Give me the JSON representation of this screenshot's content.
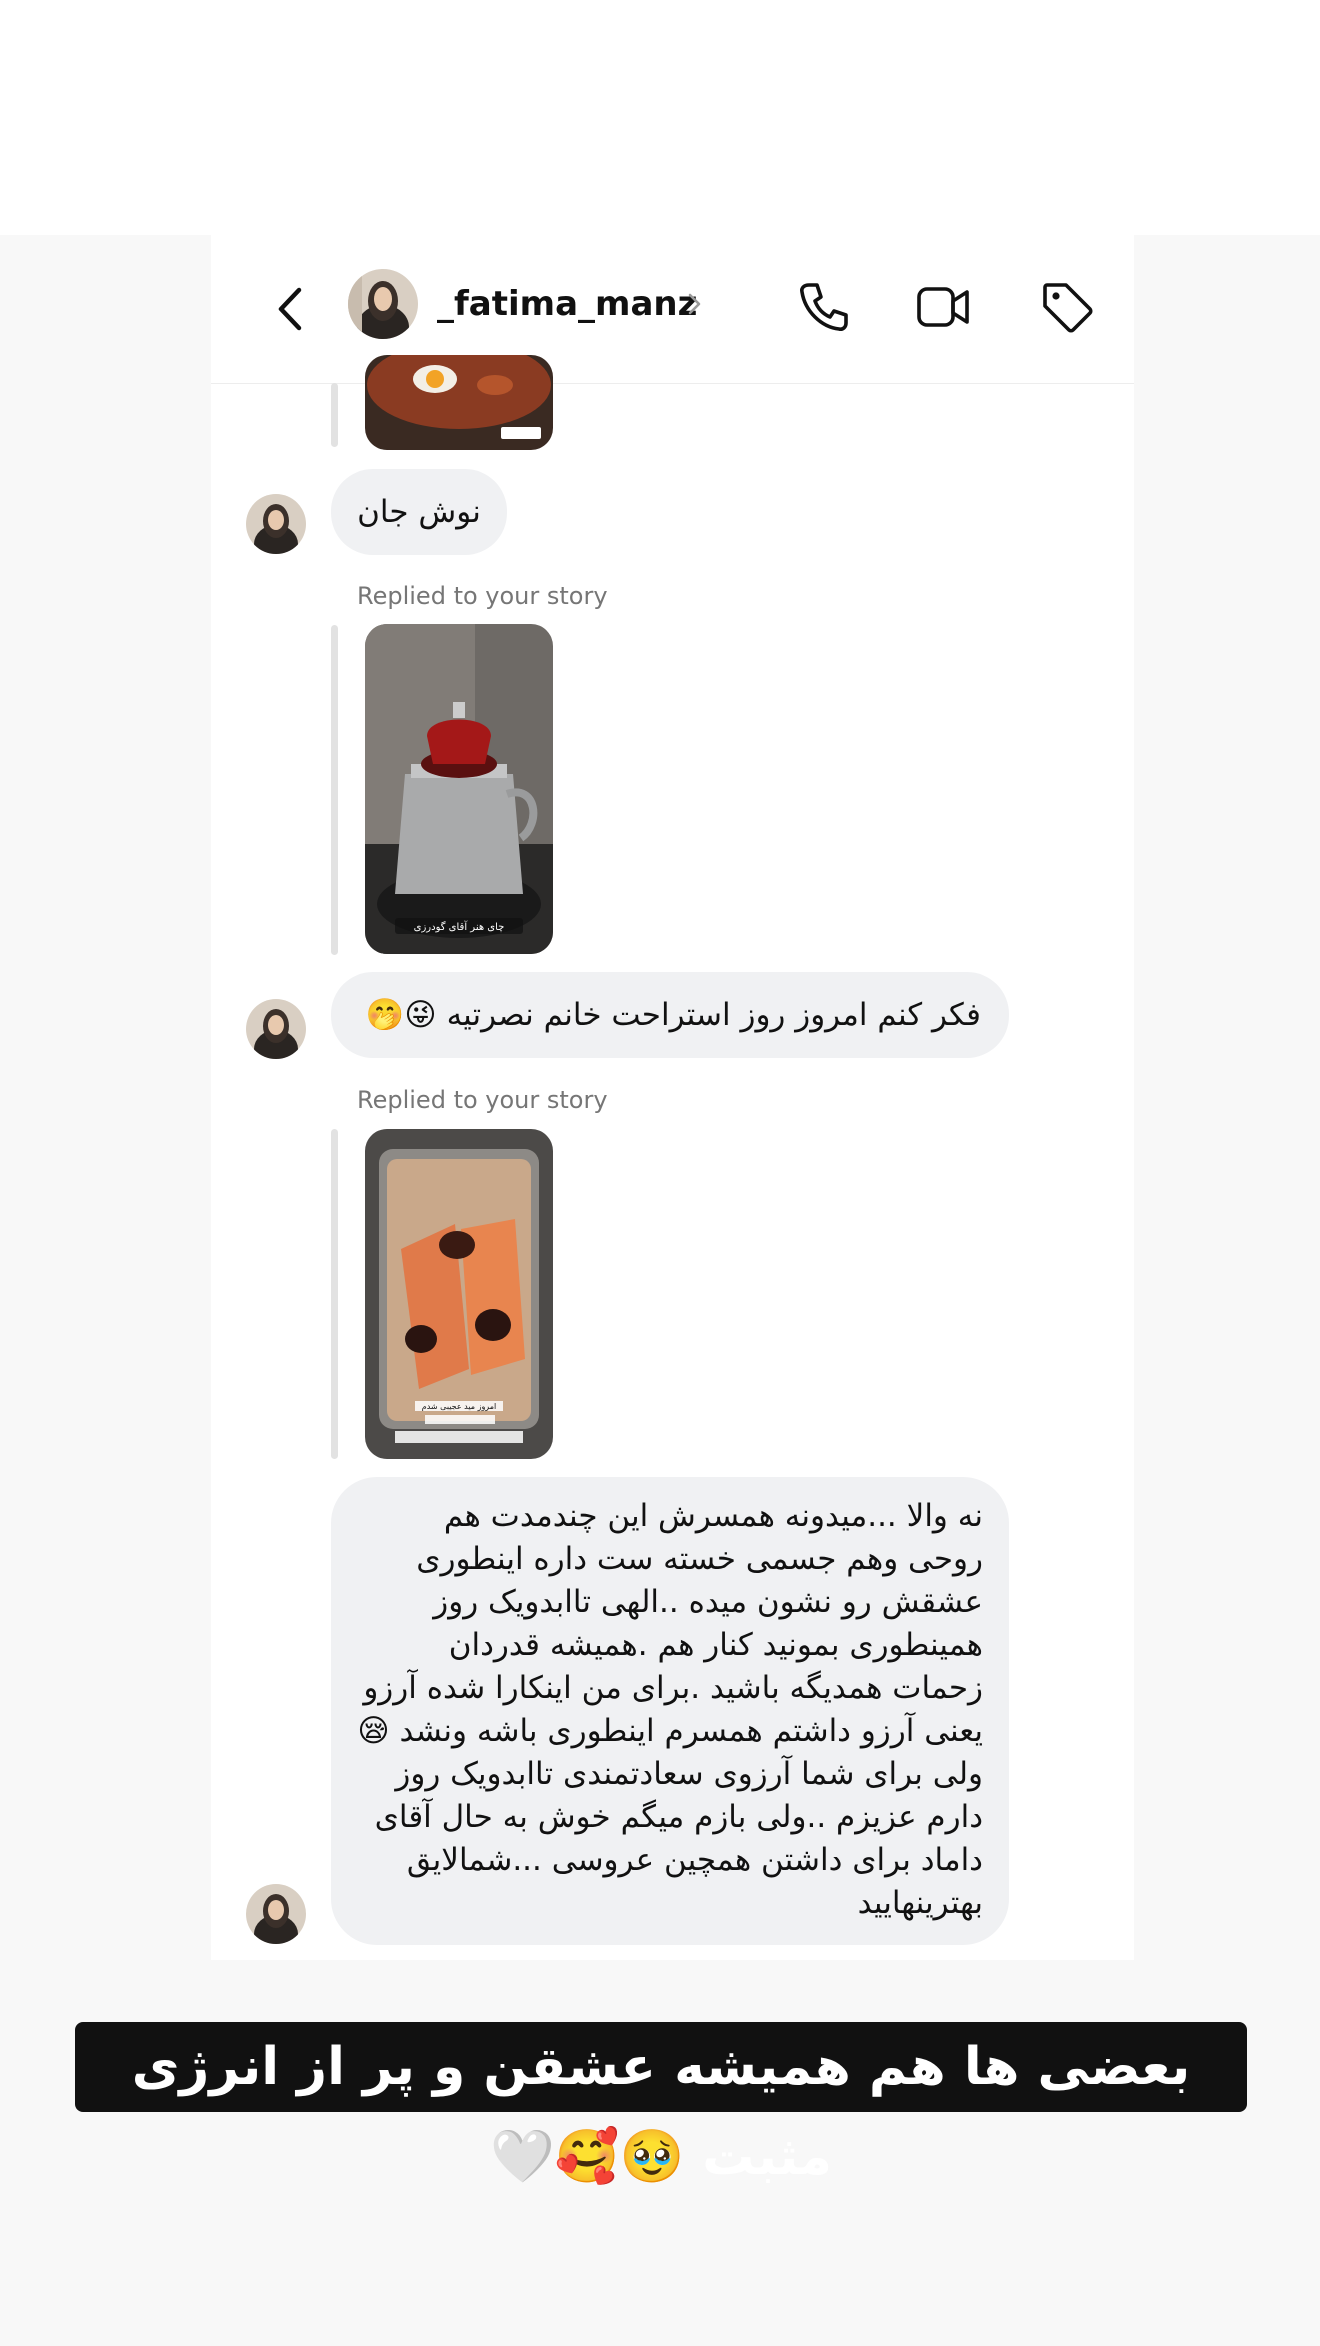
{
  "header": {
    "username": "_fatima_manz",
    "icons": [
      "back-arrow-icon",
      "chevron-right-icon",
      "phone-icon",
      "video-camera-icon",
      "tag-icon"
    ]
  },
  "messages": [
    {
      "type": "text",
      "text": "نوش جان"
    },
    {
      "type": "story_reply",
      "label": "Replied to your story",
      "story_caption": "چای هنر آقای گودرزی"
    },
    {
      "type": "text",
      "text": "فکر کنم امروز روز استراحت خانم نصرتیه 😜🤭"
    },
    {
      "type": "story_reply",
      "label": "Replied to your story",
      "story_caption": "امروز مید عجیبی شدم"
    },
    {
      "type": "text",
      "lines": [
        "نه والا ...میدونه همسرش این چندمدت هم",
        "روحی وهم جسمی خسته ست داره اینطوری",
        "عشقش رو نشون میده ..الهی تاابدویک روز",
        "همینطوری بمونید کنار هم .همیشه قدردان",
        "زحمات همدیگه باشید .برای من اینکارا شده آرزو",
        "یعنی آرزو داشتم همسرم اینطوری باشه ونشد 😪",
        "ولی برای شما آرزوی سعادتمندی تاابدویک روز",
        "دارم عزیزم ..ولی بازم میگم خوش به حال آقای",
        "داماد برای داشتن همچین  عروسی ...شمالایق",
        "بهترینهایید"
      ]
    }
  ],
  "overlay_caption": "بعضی ها هم همیشه عشقن و پر از انرژی مثبت 🥹🥰🤍",
  "colors": {
    "bubble": "#f0f1f3",
    "caption_bg": "#111111"
  }
}
